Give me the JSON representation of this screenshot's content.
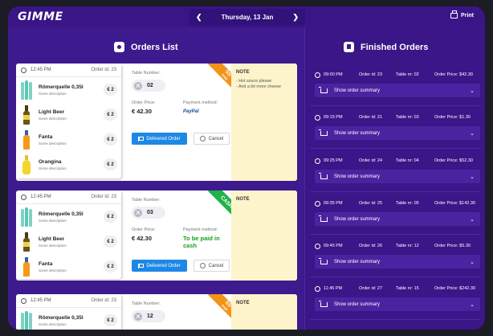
{
  "app": {
    "logo": "GIMME"
  },
  "header": {
    "date": "Thursday, 13 Jan",
    "prev_icon": "chevron-left-icon",
    "next_icon": "chevron-right-icon",
    "print_label": "Print"
  },
  "orders_list": {
    "title": "Orders List",
    "orders": [
      {
        "time": "12:45 PM",
        "order_id": "Order id: 23",
        "items": [
          {
            "name": "Römerquelle 0,35l",
            "desc": "Some description",
            "price": "€ 2"
          },
          {
            "name": "Light Beer",
            "desc": "Some description",
            "price": "€ 2"
          },
          {
            "name": "Fanta",
            "desc": "Some description",
            "price": "€ 2"
          },
          {
            "name": "Orangina",
            "desc": "Some description",
            "price": "€ 2"
          }
        ],
        "table_label": "Table Number:",
        "table_number": "02",
        "price_label": "Order Price:",
        "price": "€ 42.30",
        "payment_label": "Payment method:",
        "payment": "PayPal",
        "deliver_label": "Delivered Order",
        "cancel_label": "Cancel",
        "ribbon_top": "SS",
        "ribbon_bottom": "PAID",
        "ribbon_color": "#f39419",
        "note_title": "NOTE",
        "note_lines": [
          "- Hot souce please",
          "- And a bit more cheese"
        ]
      },
      {
        "time": "12:45 PM",
        "order_id": "Order id: 23",
        "items": [
          {
            "name": "Römerquelle 0,35l",
            "desc": "Some description",
            "price": "€ 2"
          },
          {
            "name": "Light Beer",
            "desc": "Some description",
            "price": "€ 2"
          },
          {
            "name": "Fanta",
            "desc": "Some description",
            "price": "€ 2"
          }
        ],
        "table_label": "Table Number:",
        "table_number": "03",
        "price_label": "Order Price:",
        "price": "€ 42.30",
        "payment_label": "Payment method:",
        "payment": "To be paid in cash",
        "deliver_label": "Delivered Order",
        "cancel_label": "Cancel",
        "ribbon_top": "CASH",
        "ribbon_bottom": "",
        "ribbon_color": "#21b24a",
        "note_title": "NOTE",
        "note_lines": []
      },
      {
        "time": "12:45 PM",
        "order_id": "Order id: 23",
        "items": [
          {
            "name": "Römerquelle 0,35l",
            "desc": "Some description",
            "price": "€ 2"
          }
        ],
        "table_label": "Table Number:",
        "table_number": "12",
        "ribbon_top": "SS",
        "ribbon_bottom": "PAID",
        "ribbon_color": "#f39419",
        "note_title": "NOTE",
        "note_lines": []
      }
    ]
  },
  "finished_orders": {
    "title": "Finished Orders",
    "summary_label": "Show order summary",
    "orders": [
      {
        "time": "09:00 PM",
        "order_id": "Order id: 23",
        "table": "Table nr: 02",
        "price": "Order Price: $42.30"
      },
      {
        "time": "09:15 PM",
        "order_id": "Order id: 21",
        "table": "Table nr: 03",
        "price": "Order Price: $1.30"
      },
      {
        "time": "09:25 PM",
        "order_id": "Order id: 24",
        "table": "Table nr: 04",
        "price": "Order Price: $52.30"
      },
      {
        "time": "09:35 PM",
        "order_id": "Order id: 25",
        "table": "Table nr: 05",
        "price": "Order Price: $142.30"
      },
      {
        "time": "09:45 PM",
        "order_id": "Order id: 26",
        "table": "Table nr: 12",
        "price": "Order Price: $5.30"
      },
      {
        "time": "11:45 PM",
        "order_id": "Order id: 27",
        "table": "Table nr: 15",
        "price": "Order Price: $242.30"
      }
    ]
  },
  "colors": {
    "background": "#3e1a8f",
    "primary_button": "#1e88e5",
    "note_bg": "#fdf4cc",
    "cash_text": "#16a01d"
  }
}
